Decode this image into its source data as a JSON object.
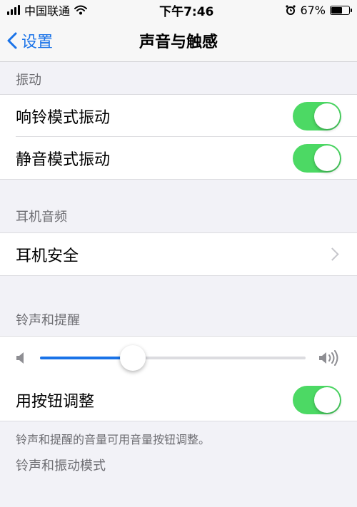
{
  "status_bar": {
    "carrier": "中国联通",
    "time": "下午7:46",
    "battery_text": "67%",
    "battery_level": 0.67,
    "icons": [
      "signal-icon",
      "wifi-icon",
      "alarm-icon",
      "battery-icon"
    ]
  },
  "nav": {
    "back_label": "设置",
    "title": "声音与触感"
  },
  "sections": {
    "vibration": {
      "header": "振动",
      "rows": [
        {
          "label": "响铃模式振动",
          "on": true
        },
        {
          "label": "静音模式振动",
          "on": true
        }
      ]
    },
    "headphone": {
      "header": "耳机音频",
      "row_label": "耳机安全"
    },
    "ringer": {
      "header": "铃声和提醒",
      "volume_level": 0.35,
      "button_adjust_label": "用按钮调整",
      "button_adjust_on": true,
      "footnote": "铃声和提醒的音量可用音量按钮调整。"
    },
    "patterns": {
      "header": "铃声和振动模式"
    }
  },
  "colors": {
    "accent": "#1a73e8",
    "toggle_on": "#4cd964",
    "background": "#f2f2f7"
  }
}
